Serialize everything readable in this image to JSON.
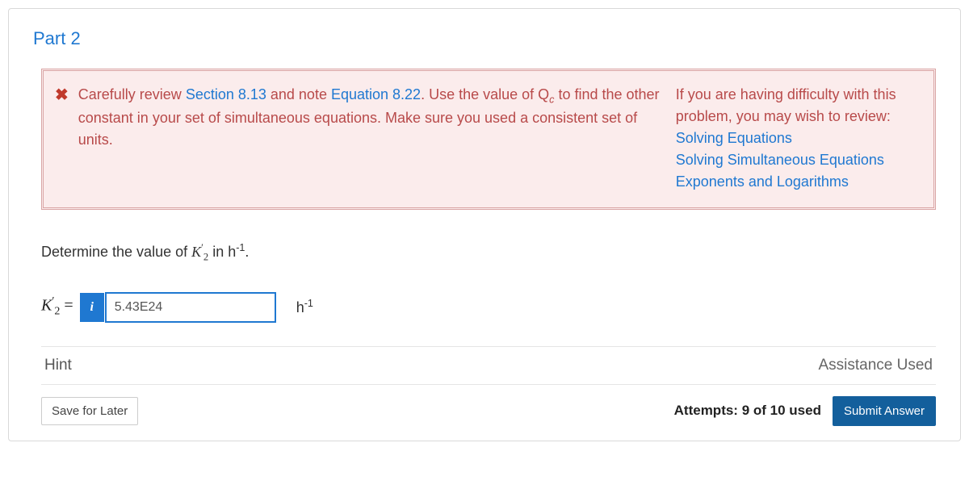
{
  "part_title": "Part 2",
  "feedback": {
    "text_before_link1": "Carefully review ",
    "link1": "Section 8.13",
    "text_mid1": " and note ",
    "link2": "Equation 8.22",
    "text_after": ". Use the value of Q",
    "text_after_sub": "c",
    "text_tail": " to find the other constant in your set of simultaneous equations. Make sure you used a consistent set of units.",
    "help_intro": "If you are having difficulty with this problem, you may wish to review:",
    "help_links": {
      "a": "Solving Equations",
      "b": "Solving Simultaneous Equations",
      "c": "Exponents and Logarithms"
    }
  },
  "prompt": {
    "lead": "Determine the value of ",
    "var": "K",
    "prime": "′",
    "sub": "2",
    "mid": " in h",
    "exp": "-1",
    "end": "."
  },
  "input": {
    "lhs_var": "K",
    "lhs_prime": "′",
    "lhs_sub": "2",
    "equals": " = ",
    "info": "i",
    "value": "5.43E24",
    "unit_base": "h",
    "unit_exp": "-1"
  },
  "hint_label": "Hint",
  "assist_label": "Assistance Used",
  "save_label": "Save for Later",
  "attempts": "Attempts: 9 of 10 used",
  "submit_label": "Submit Answer"
}
